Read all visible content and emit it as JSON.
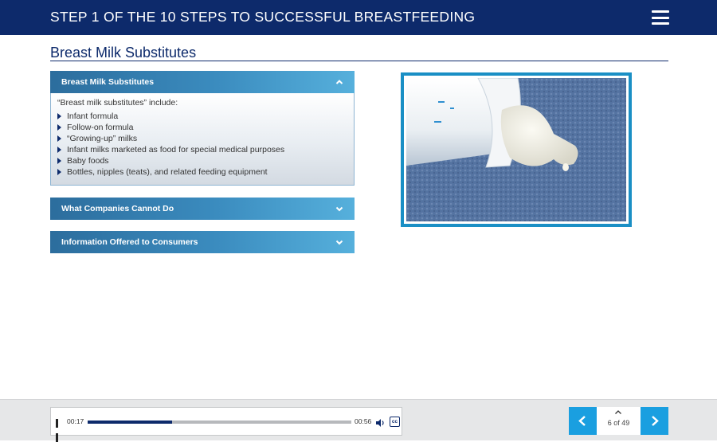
{
  "header": {
    "title": "STEP 1 OF THE 10 STEPS TO SUCCESSFUL BREASTFEEDING",
    "menu_icon": "hamburger-menu-icon"
  },
  "page": {
    "title": "Breast Milk Substitutes"
  },
  "accordion": {
    "sections": [
      {
        "label": "Breast Milk Substitutes",
        "expanded": true,
        "intro": "“Breast milk substitutes” include:",
        "items": [
          "Infant formula",
          "Follow-on formula",
          "“Growing-up” milks",
          "Infant milks marketed as food for special medical purposes",
          "Baby foods",
          "Bottles, nipples (teats), and related feeding equipment"
        ]
      },
      {
        "label": "What Companies Cannot Do",
        "expanded": false
      },
      {
        "label": "Information Offered to Consumers",
        "expanded": false
      }
    ]
  },
  "image": {
    "subject": "baby-bottle-photo"
  },
  "player": {
    "current_time": "00:17",
    "duration": "00:56",
    "progress": 0.32,
    "cc_label": "cc"
  },
  "pagination": {
    "label": "6 of 49"
  },
  "colors": {
    "header_bg": "#0d2a6b",
    "accordion_start": "#2c6d9d",
    "accordion_end": "#56b0dc",
    "nav_button": "#1a9fe0",
    "image_border": "#1a8fc5"
  }
}
